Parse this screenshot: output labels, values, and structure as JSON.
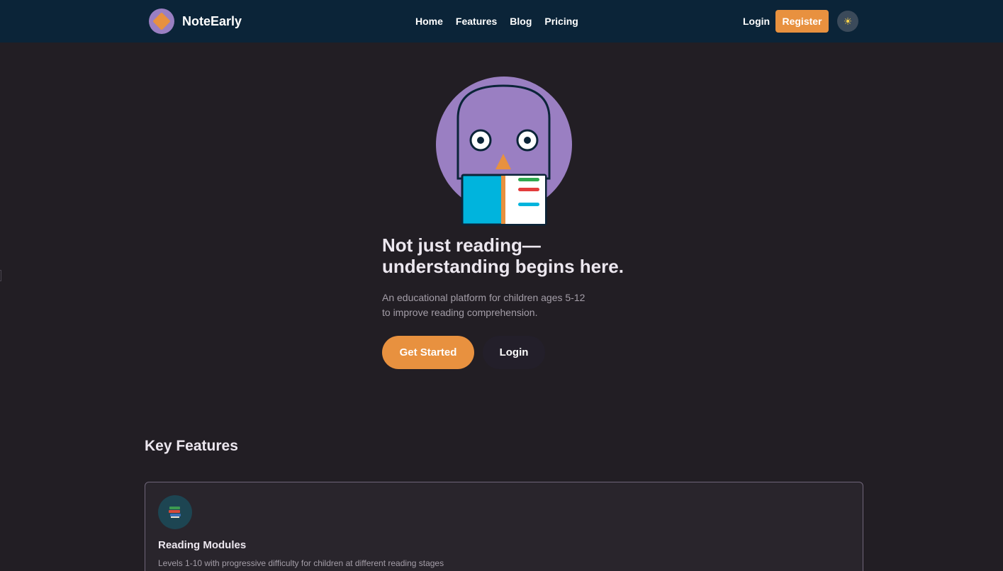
{
  "header": {
    "brand": "NoteEarly",
    "nav": [
      "Home",
      "Features",
      "Blog",
      "Pricing"
    ],
    "login": "Login",
    "register": "Register",
    "theme_icon": "sun-icon"
  },
  "hero": {
    "title_line1": "Not just reading—",
    "title_line2": "understanding begins here.",
    "subtitle_line1": "An educational platform for children ages 5-12",
    "subtitle_line2": "to improve reading comprehension.",
    "primary_button": "Get Started",
    "secondary_button": "Login"
  },
  "features": {
    "heading": "Key Features",
    "items": [
      {
        "icon": "books-icon",
        "title": "Reading Modules",
        "description": "Levels 1-10 with progressive difficulty for children at different reading stages"
      }
    ]
  },
  "colors": {
    "accent": "#e8913f",
    "header_bg": "#0b2438",
    "page_bg": "#221e24",
    "mascot_purple": "#9a7fc2"
  }
}
